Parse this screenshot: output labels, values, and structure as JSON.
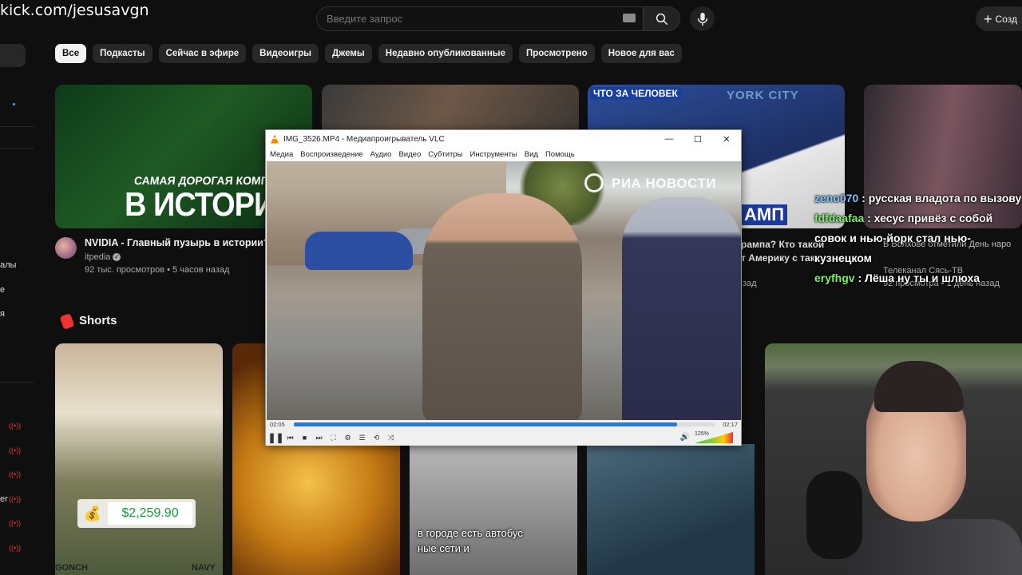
{
  "overlay": {
    "url": "kick.com/jesusavgn"
  },
  "header": {
    "search_placeholder": "Введите запрос",
    "create_label": "Созд"
  },
  "sidebar": {
    "fragments": [
      "алы",
      "е",
      "я",
      "er"
    ]
  },
  "chips": [
    "Все",
    "Подкасты",
    "Сейчас в эфире",
    "Видеоигры",
    "Джемы",
    "Недавно опубликованные",
    "Просмотрено",
    "Новое для вас"
  ],
  "videos": [
    {
      "thumb_line1": "САМАЯ ДОРОГАЯ КОМПАНИЯ",
      "thumb_line2": "В ИСТОРИИ",
      "title": "NVIDIA - Главный пузырь в истории?",
      "channel": "itpedia",
      "meta": "92 тыс. просмотров • 5 часов назад"
    },
    {
      "thumb_label": "ЧТО ЗА ЧЕЛОВЕК",
      "thumb_city": "YORK CITY",
      "thumb_word": "АМП",
      "title_frag1": "рампа? Кто такой",
      "title_frag2": "т Америку с так",
      "meta_frag": "зад"
    },
    {
      "title_frag": "В Волхове отметили День наро",
      "channel": "Телеканал Сясь-ТВ",
      "meta": "92 просмотра • 1 день назад"
    }
  ],
  "shorts": {
    "title": "Shorts",
    "price": "$2,259.90",
    "caption_line1": "в городе есть автобус",
    "caption_line2": "ные сети и",
    "uniform_left": "GONCH",
    "uniform_right": "NAVY"
  },
  "chat": [
    {
      "user": "zeno070",
      "text": " : русская влaдота по вызову"
    },
    {
      "user": "fdfdaafaa",
      "text": " : хесус привёз с собой совок и нью-йорк стал нью-кузнецком"
    },
    {
      "user": "eryfhgv",
      "text": " : Лёша ну ты и шлюха"
    }
  ],
  "vlc": {
    "title": "IMG_3526.MP4 - Медиапроигрыватель VLC",
    "menu": [
      "Медиа",
      "Воспроизведение",
      "Аудио",
      "Видео",
      "Субтитры",
      "Инструменты",
      "Вид",
      "Помощь"
    ],
    "watermark": "РИА НОВОСТИ",
    "time_current": "02:05",
    "time_total": "02:17",
    "progress": 0.91,
    "volume": "125%"
  }
}
